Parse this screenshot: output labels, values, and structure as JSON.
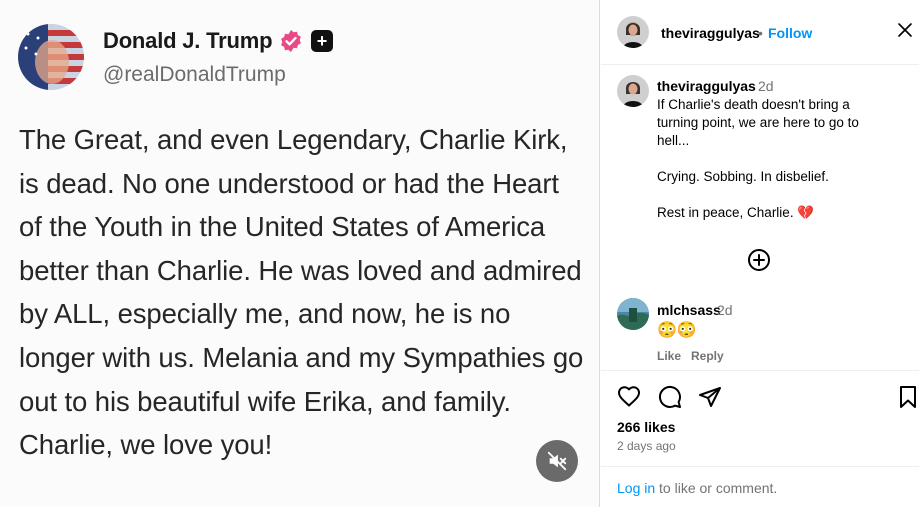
{
  "tweet": {
    "name": "Donald J. Trump",
    "handle": "@realDonaldTrump",
    "text": "The Great, and even Legendary, Charlie Kirk, is dead. No one understood or had the Heart of the Youth in the United States of America better than Charlie. He was loved and admired by ALL, especially me, and now, he is no longer with us. Melania and my Sympathies go out to his beautiful wife Erika, and family. Charlie, we love you!",
    "plus_badge": "+",
    "verified_color": "#e94a86"
  },
  "post": {
    "username": "theviraggulyas",
    "dot": "•",
    "follow_label": "Follow",
    "caption": {
      "username": "theviraggulyas",
      "time": "2d",
      "text": "If Charlie's death doesn't bring a turning point, we are here to go to hell...\n\nCrying. Sobbing. In disbelief.\n\nRest in peace, Charlie. 💔"
    },
    "comment": {
      "username": "mlchsass",
      "time": "2d",
      "text": "😳😳",
      "like_label": "Like",
      "reply_label": "Reply"
    },
    "likes": "266 likes",
    "ago": "2 days ago",
    "login_link": "Log in",
    "login_rest": " to like or comment."
  },
  "colors": {
    "accent": "#0095f6",
    "muted": "#737373"
  },
  "icons": [
    "close-icon",
    "add-comment-icon",
    "heart-icon",
    "comment-icon",
    "share-icon",
    "bookmark-icon",
    "mute-icon",
    "verified-icon"
  ]
}
